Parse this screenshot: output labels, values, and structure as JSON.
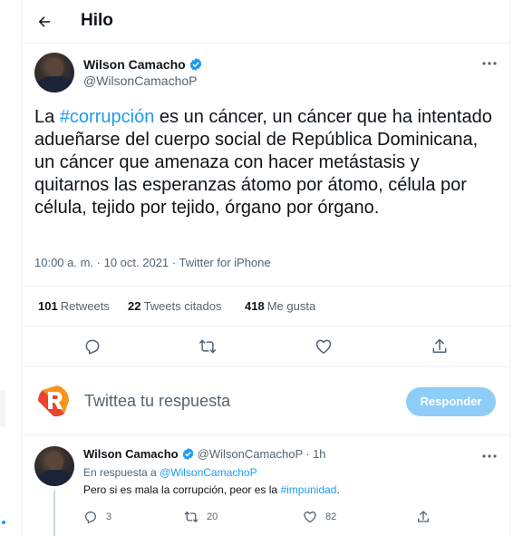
{
  "header": {
    "title": "Hilo"
  },
  "main_tweet": {
    "author_name": "Wilson Camacho",
    "author_handle": "@WilsonCamachoP",
    "text_before": "La ",
    "hashtag": "#corrupción",
    "text_after": " es un cáncer, un cáncer que ha intentado adueñarse del cuerpo social de República Dominicana, un cáncer que amenaza con hacer metástasis y quitarnos las esperanzas átomo por átomo, célula por célula, tejido por tejido, órgano por órgano.",
    "meta": "10:00 a. m. · 10 oct. 2021 · Twitter for iPhone",
    "stats": {
      "retweets_count": "101",
      "retweets_label": "Retweets",
      "quotes_count": "22",
      "quotes_label": "Tweets citados",
      "likes_count": "418",
      "likes_label": "Me gusta"
    }
  },
  "composer": {
    "placeholder": "Twittea tu respuesta",
    "reply_button": "Responder"
  },
  "reply_tweet": {
    "author_name": "Wilson Camacho",
    "author_handle": "@WilsonCamachoP",
    "time": "· 1h",
    "in_reply_prefix": "En respuesta a ",
    "in_reply_mention": "@WilsonCamachoP",
    "text_before": "Pero si es mala la corrupción, peor es la ",
    "hashtag": "#impunidad",
    "text_after": ".",
    "replies": "3",
    "retweets": "20",
    "likes": "82"
  },
  "colors": {
    "accent": "#1d9bf0",
    "reply_button_disabled": "#8ecdf8",
    "logo_orange": "#f26722"
  },
  "icons": [
    "back-arrow-icon",
    "verified-badge-icon",
    "more-icon",
    "reply-icon",
    "retweet-icon",
    "like-icon",
    "share-icon"
  ]
}
